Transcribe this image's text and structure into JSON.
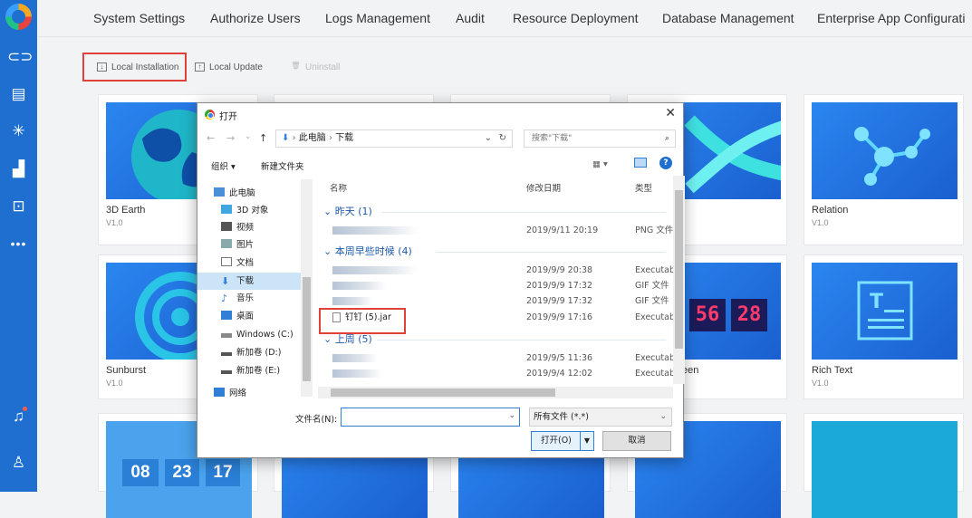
{
  "nav": {
    "items": [
      "System Settings",
      "Authorize Users",
      "Logs Management",
      "Audit",
      "Resource Deployment",
      "Database Management",
      "Enterprise App Configurati"
    ]
  },
  "toolbar": {
    "local_installation": "Local Installation",
    "local_update": "Local Update",
    "uninstall": "Uninstall"
  },
  "cards": [
    {
      "name": "3D Earth",
      "version": "V1.0"
    },
    {
      "name": "Relation",
      "version": "V1.0"
    },
    {
      "name": "Sunburst",
      "version": "V1.0"
    },
    {
      "name": "een",
      "version": ""
    },
    {
      "name": "Rich Text",
      "version": "V1.0"
    }
  ],
  "thumb_text": {
    "countdown": [
      "08",
      "23",
      "17"
    ],
    "led": [
      "56",
      "28"
    ]
  },
  "dialog": {
    "title": "打开",
    "close": "✕",
    "path": [
      "此电脑",
      "下载"
    ],
    "search_placeholder": "搜索\"下载\"",
    "organize": "组织 ▾",
    "new_folder": "新建文件夹",
    "nav_items": [
      "此电脑",
      "3D 对象",
      "视频",
      "图片",
      "文档",
      "下载",
      "音乐",
      "桌面",
      "Windows (C:)",
      "新加卷 (D:)",
      "新加卷 (E:)",
      "网络"
    ],
    "columns": {
      "name": "名称",
      "date": "修改日期",
      "type": "类型"
    },
    "groups": [
      "昨天 (1)",
      "本周早些时候 (4)",
      "上周 (5)"
    ],
    "rows": [
      {
        "date": "2019/9/11 20:19",
        "type": "PNG 文件"
      },
      {
        "date": "2019/9/9 20:38",
        "type": "Executable"
      },
      {
        "date": "2019/9/9 17:32",
        "type": "GIF 文件"
      },
      {
        "date": "2019/9/9 17:32",
        "type": "GIF 文件"
      },
      {
        "name": "钉钉 (5).jar",
        "date": "2019/9/9 17:16",
        "type": "Executable"
      },
      {
        "date": "2019/9/5 11:36",
        "type": "Executable"
      },
      {
        "date": "2019/9/4 12:02",
        "type": "Executable"
      }
    ],
    "filename_label": "文件名(N):",
    "filename_value": "",
    "filetype": "所有文件 (*.*)",
    "open_button": "打开(O)",
    "cancel_button": "取消"
  },
  "colors": {
    "sidebar": "#1e6fd0",
    "accent": "#2b86f0",
    "highlight": "#e0413a"
  }
}
